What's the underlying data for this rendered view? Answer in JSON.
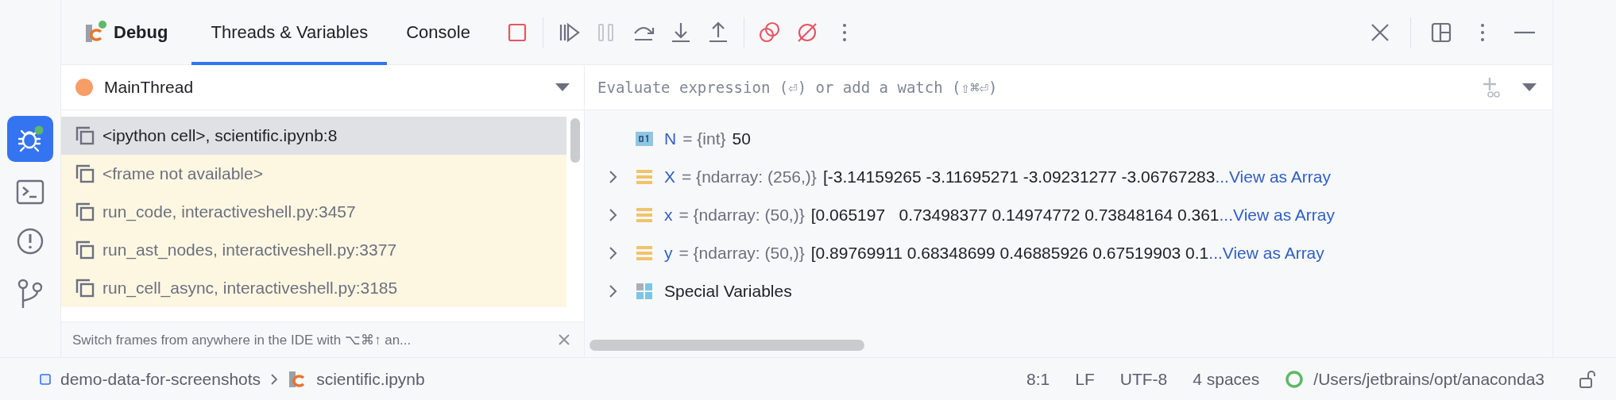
{
  "tool_window": {
    "title": "Debug"
  },
  "tabs": [
    {
      "label": "Threads & Variables",
      "selected": true
    },
    {
      "label": "Console",
      "selected": false
    }
  ],
  "debug_toolbar": [
    {
      "kind": "stop",
      "disabled": false
    },
    {
      "kind": "resume",
      "disabled": false
    },
    {
      "kind": "pause",
      "disabled": true
    },
    {
      "kind": "step-over",
      "disabled": false
    },
    {
      "kind": "step-into",
      "disabled": false
    },
    {
      "kind": "step-out",
      "disabled": false
    },
    {
      "kind": "breakpoints",
      "disabled": false
    },
    {
      "kind": "mute",
      "disabled": false
    },
    {
      "kind": "more",
      "disabled": false
    }
  ],
  "thread_selector": {
    "value": "MainThread"
  },
  "frames": [
    {
      "label": "<ipython cell>, scientific.ipynb:8",
      "selected": true,
      "library": false
    },
    {
      "label": "<frame not available>",
      "selected": false,
      "library": true
    },
    {
      "label": "run_code, interactiveshell.py:3457",
      "selected": false,
      "library": true
    },
    {
      "label": "run_ast_nodes, interactiveshell.py:3377",
      "selected": false,
      "library": true
    },
    {
      "label": "run_cell_async, interactiveshell.py:3185",
      "selected": false,
      "library": true
    }
  ],
  "frames_hint": "Switch frames from anywhere in the IDE with ⌥⌘↑ an...",
  "evaluate_field": {
    "placeholder": "Evaluate expression (⏎) or add a watch (⇧⌘⏎)"
  },
  "variables": [
    {
      "kind": "int",
      "name": "N",
      "type": "= {int}",
      "value": "50"
    },
    {
      "kind": "array",
      "name": "X",
      "type": "= {ndarray: (256,)}",
      "value": "[-3.14159265 -3.11695271 -3.09231277 -3.06767283",
      "link": "...View as Array",
      "expanded": false
    },
    {
      "kind": "array",
      "name": "x",
      "type": "= {ndarray: (50,)}",
      "value": "[0.065197   0.73498377 0.14974772 0.73848164 0.361",
      "link": "...View as Array",
      "expanded": false
    },
    {
      "kind": "array",
      "name": "y",
      "type": "= {ndarray: (50,)}",
      "value": "[0.89769911 0.68348699 0.46885926 0.67519903 0.1",
      "link": "...View as Array",
      "expanded": false
    },
    {
      "kind": "group",
      "name": "Special Variables",
      "expanded": false
    }
  ],
  "status_bar": {
    "project": "demo-data-for-screenshots",
    "file": "scientific.ipynb",
    "items": [
      "8:1",
      "LF",
      "UTF-8",
      "4 spaces"
    ],
    "interpreter": "/Users/jetbrains/opt/anaconda3"
  }
}
